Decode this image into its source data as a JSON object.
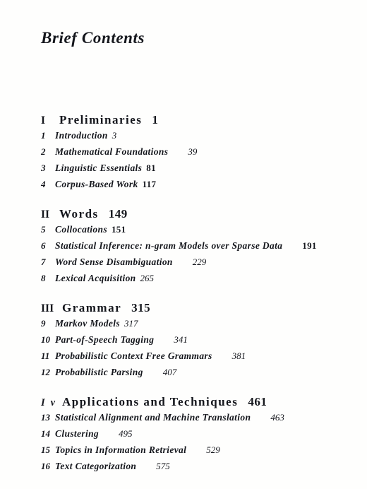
{
  "document": {
    "title": "Brief Contents"
  },
  "parts": [
    {
      "numeral": "I",
      "title": "Preliminaries",
      "page": "1",
      "chapters": [
        {
          "num": "1",
          "title": "Introduction",
          "page": "3",
          "weight": "light",
          "gap": "gap-s"
        },
        {
          "num": "2",
          "title": "Mathematical  Foundations",
          "page": "39",
          "weight": "light",
          "gap": "gap-l"
        },
        {
          "num": "3",
          "title": "Linguistic Essentials",
          "page": "81",
          "weight": "bold",
          "gap": "gap-s"
        },
        {
          "num": "4",
          "title": "Corpus-Based  Work",
          "page": "117",
          "weight": "bold",
          "gap": "gap-s"
        }
      ]
    },
    {
      "numeral": "II",
      "title": "Words",
      "page": "149",
      "chapters": [
        {
          "num": "5",
          "title": "Collocations",
          "page": "151",
          "weight": "bold",
          "gap": "gap-s"
        },
        {
          "num": "6",
          "title": "Statistical Inference: n-gram Models over Sparse Data",
          "page": "191",
          "weight": "bold",
          "gap": "gap-l"
        },
        {
          "num": "7",
          "title": "Word Sense Disambiguation",
          "page": "229",
          "weight": "light",
          "gap": "gap-l"
        },
        {
          "num": "8",
          "title": "Lexical  Acquisition",
          "page": "265",
          "weight": "light",
          "gap": "gap-s"
        }
      ]
    },
    {
      "numeral": "III",
      "title": "Grammar",
      "page": "315",
      "chapters": [
        {
          "num": "9",
          "title": "Markov  Models",
          "page": "317",
          "weight": "light",
          "gap": "gap-s"
        },
        {
          "num": "10",
          "title": "Part-of-Speech  Tagging",
          "page": "341",
          "weight": "light",
          "gap": "gap-l"
        },
        {
          "num": "11",
          "title": "Probabilistic Context Free Grammars",
          "page": "381",
          "weight": "light",
          "gap": "gap-l"
        },
        {
          "num": "12",
          "title": "Probabilistic Parsing",
          "page": "407",
          "weight": "light",
          "gap": "gap-l"
        }
      ]
    },
    {
      "numeral": "I v",
      "numeral_artifact": true,
      "title": "Applications and Techniques",
      "page": "461",
      "chapters": [
        {
          "num": "13",
          "title": "Statistical Alignment and Machine Translation",
          "page": "463",
          "weight": "light",
          "gap": "gap-l"
        },
        {
          "num": "14",
          "title": "Clustering",
          "page": "495",
          "weight": "light",
          "gap": "gap-l"
        },
        {
          "num": "15",
          "title": "Topics in Information Retrieval",
          "page": "529",
          "weight": "light",
          "gap": "gap-l"
        },
        {
          "num": "16",
          "title": "Text  Categorization",
          "page": "575",
          "weight": "light",
          "gap": "gap-l"
        }
      ]
    }
  ]
}
